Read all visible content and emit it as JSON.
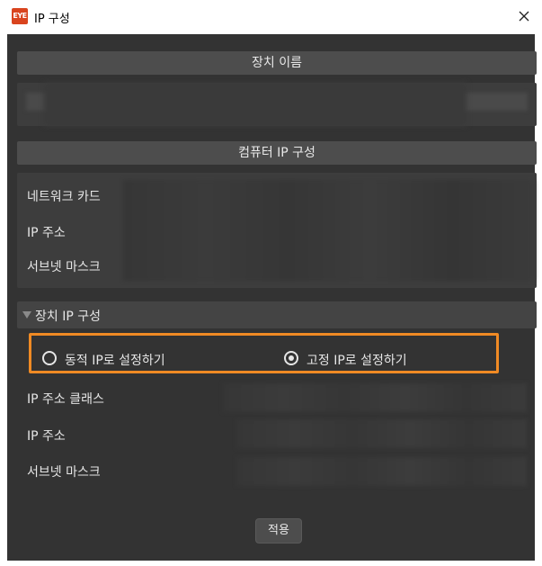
{
  "window": {
    "title": "IP 구성",
    "logo_text": "EYE"
  },
  "sections": {
    "device_name_header": "장치 이름",
    "computer_ip_header": "컴퓨터 IP 구성",
    "computer_rows": [
      "네트워크 카드",
      "IP 주소",
      "서브넷 마스크"
    ],
    "device_ip_header": "장치 IP 구성",
    "device_rows": [
      "IP 주소 클래스",
      "IP 주소",
      "서브넷 마스크"
    ]
  },
  "radio": {
    "dynamic_label": "동적 IP로 설정하기",
    "static_label": "고정 IP로 설정하기",
    "selected": "static"
  },
  "buttons": {
    "apply_label": "적용"
  },
  "colors": {
    "highlight": "#f08a24",
    "dialog_bg": "#333333"
  }
}
